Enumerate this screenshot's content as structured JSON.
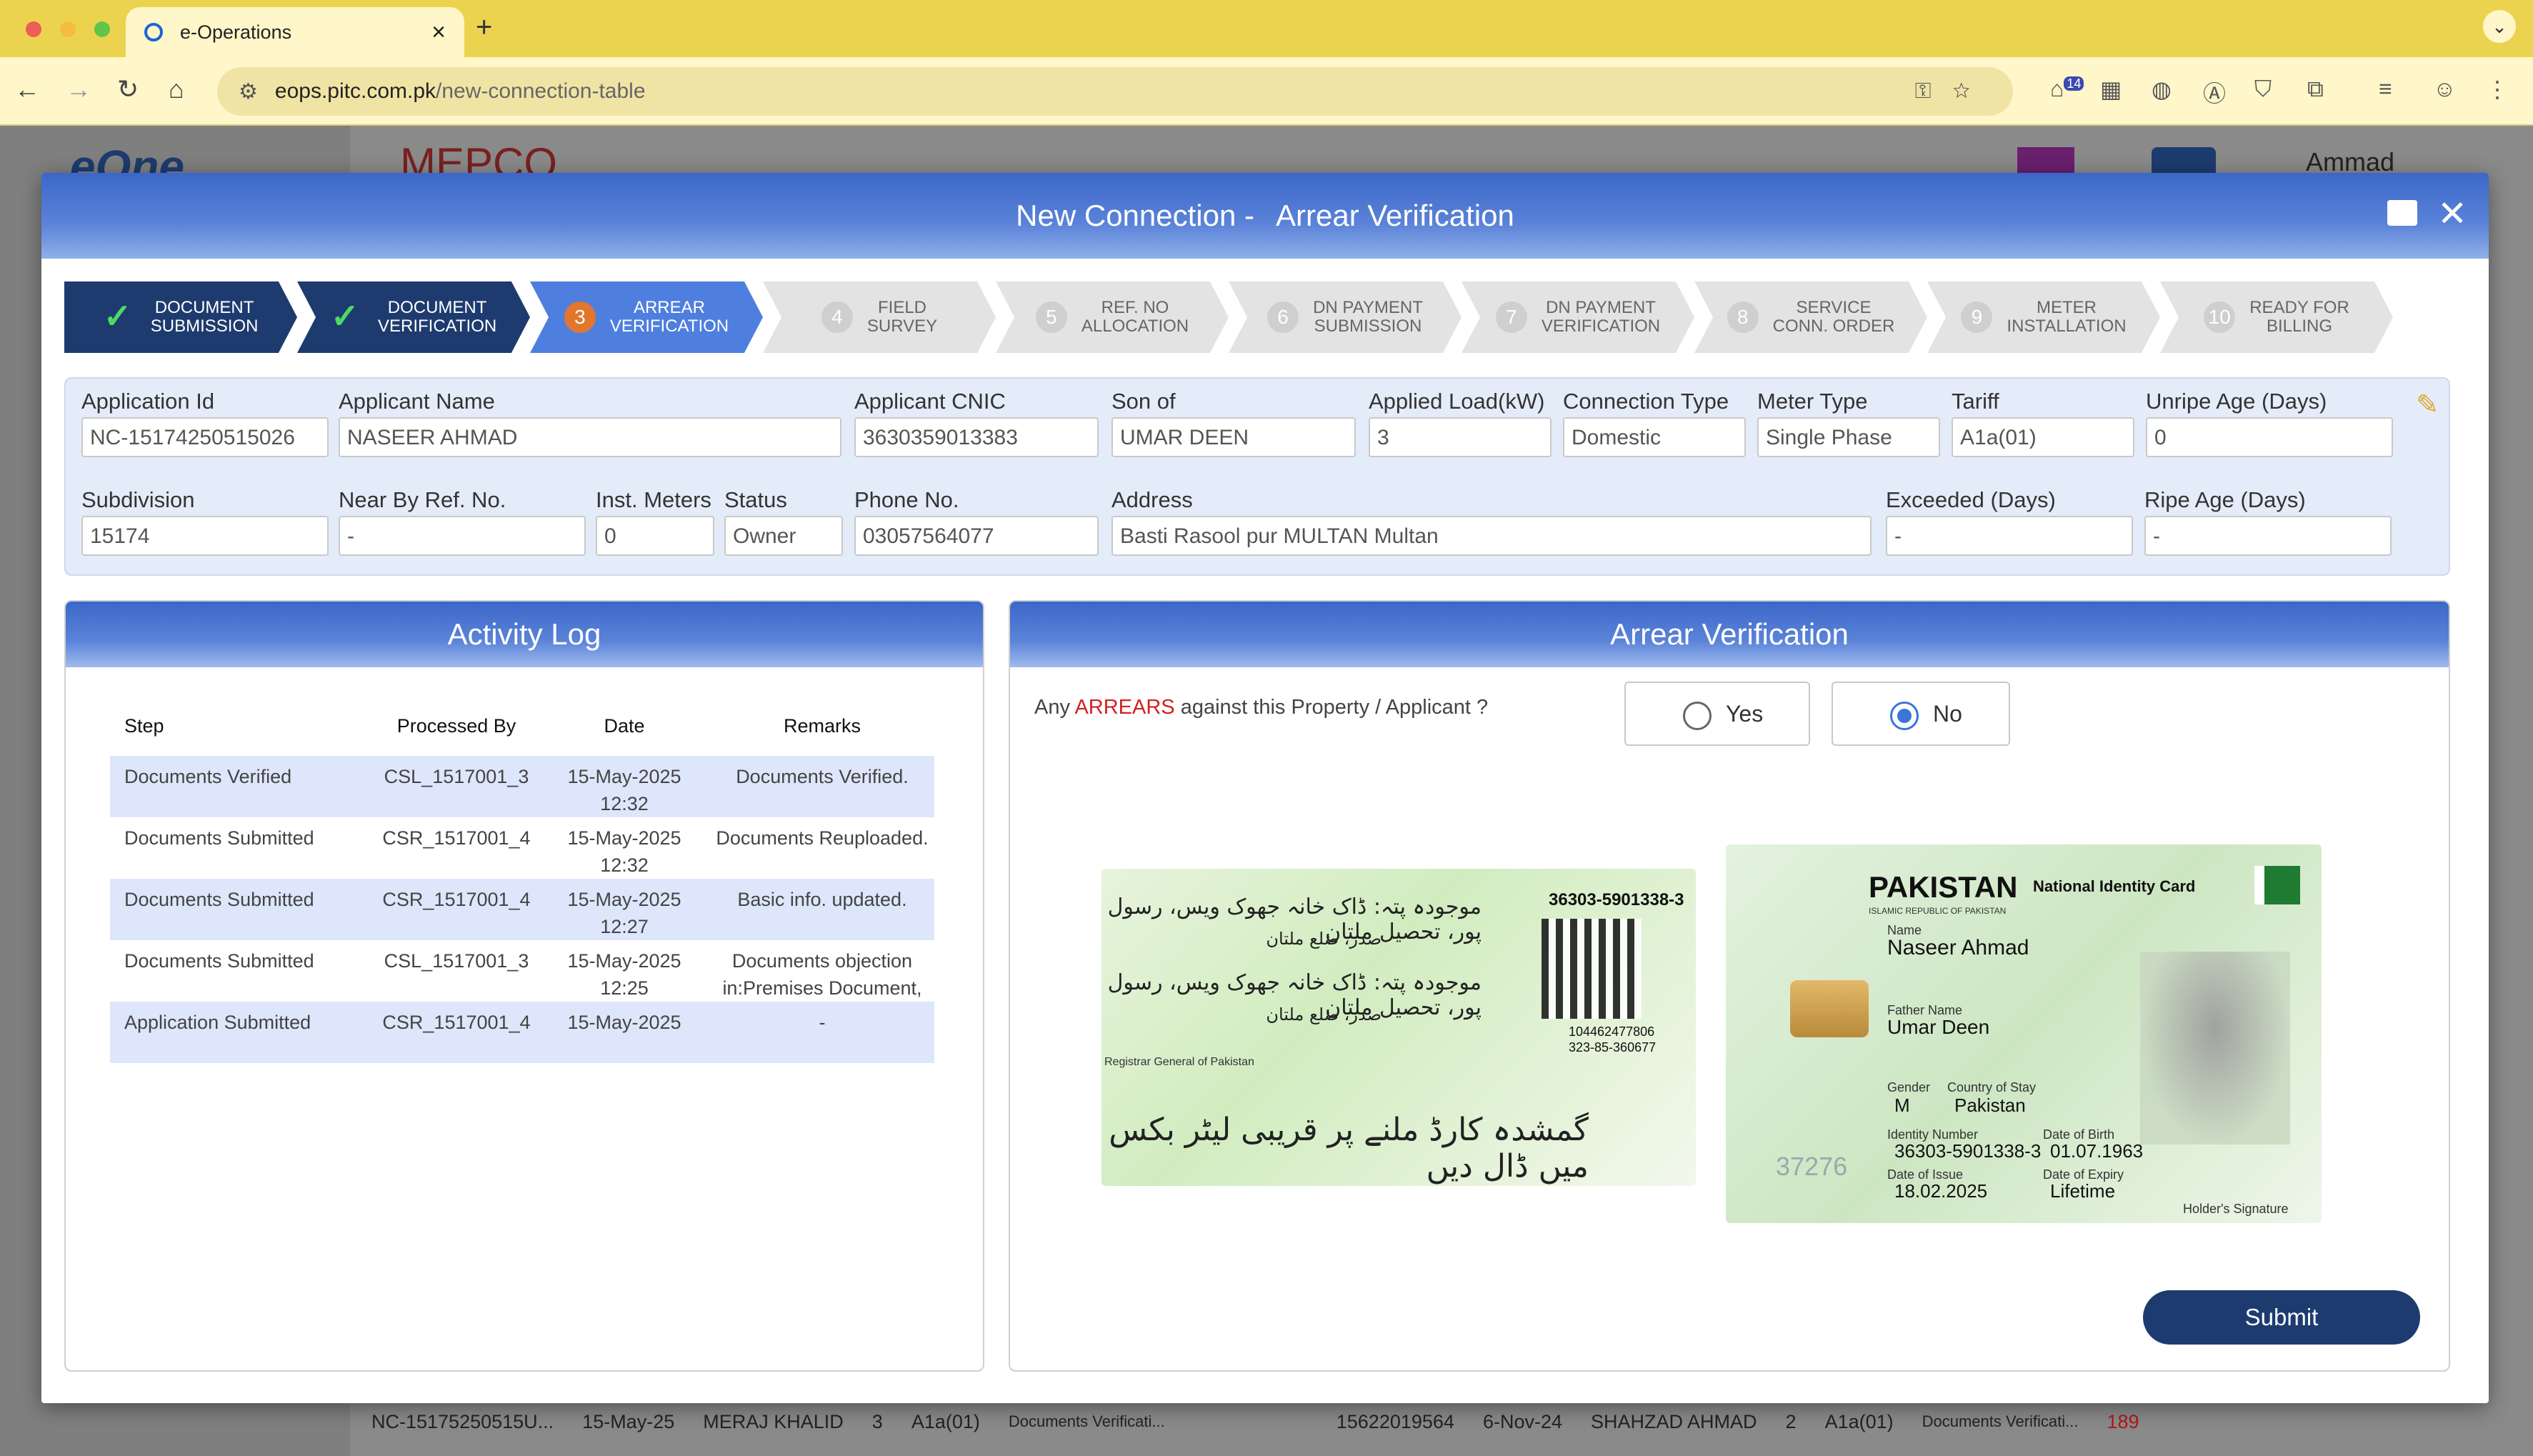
{
  "browser": {
    "tab_title": "e-Operations",
    "url_host": "eops.pitc.com.pk",
    "url_path": "/new-connection-table",
    "ext_badge": "14"
  },
  "background": {
    "user_name": "Ammad",
    "rows": [
      [
        "NC-15175250515U...",
        "15-May-25",
        "MERAJ KHALID",
        "3",
        "A1a(01)",
        "Documents Verificati..."
      ],
      [
        "15622019564",
        "6-Nov-24",
        "SHAHZAD AHMAD",
        "2",
        "A1a(01)",
        "Documents Verificati...",
        "189"
      ]
    ]
  },
  "modal": {
    "title_prefix": "New Connection -",
    "title_suffix": "Arrear Verification",
    "steps": [
      {
        "n": "1",
        "label1": "DOCUMENT",
        "label2": "SUBMISSION",
        "state": "done"
      },
      {
        "n": "2",
        "label1": "DOCUMENT",
        "label2": "VERIFICATION",
        "state": "done"
      },
      {
        "n": "3",
        "label1": "ARREAR",
        "label2": "VERIFICATION",
        "state": "active"
      },
      {
        "n": "4",
        "label1": "FIELD",
        "label2": "SURVEY",
        "state": "todo"
      },
      {
        "n": "5",
        "label1": "REF. NO",
        "label2": "ALLOCATION",
        "state": "todo"
      },
      {
        "n": "6",
        "label1": "DN PAYMENT",
        "label2": "SUBMISSION",
        "state": "todo"
      },
      {
        "n": "7",
        "label1": "DN PAYMENT",
        "label2": "VERIFICATION",
        "state": "todo"
      },
      {
        "n": "8",
        "label1": "SERVICE",
        "label2": "CONN. ORDER",
        "state": "todo"
      },
      {
        "n": "9",
        "label1": "METER",
        "label2": "INSTALLATION",
        "state": "todo"
      },
      {
        "n": "10",
        "label1": "READY FOR",
        "label2": "BILLING",
        "state": "todo"
      }
    ],
    "fields": {
      "application_id": {
        "label": "Application Id",
        "value": "NC-15174250515026"
      },
      "applicant_name": {
        "label": "Applicant Name",
        "value": "NASEER AHMAD"
      },
      "applicant_cnic": {
        "label": "Applicant CNIC",
        "value": "3630359013383"
      },
      "son_of": {
        "label": "Son of",
        "value": "UMAR DEEN"
      },
      "applied_load": {
        "label": "Applied Load(kW)",
        "value": "3"
      },
      "connection_type": {
        "label": "Connection Type",
        "value": "Domestic"
      },
      "meter_type": {
        "label": "Meter Type",
        "value": "Single Phase"
      },
      "tariff": {
        "label": "Tariff",
        "value": "A1a(01)"
      },
      "unripe_age": {
        "label": "Unripe Age (Days)",
        "value": "0"
      },
      "subdivision": {
        "label": "Subdivision",
        "value": "15174"
      },
      "near_by_ref": {
        "label": "Near By Ref. No.",
        "value": "-"
      },
      "inst_meters": {
        "label": "Inst. Meters",
        "value": "0"
      },
      "status": {
        "label": "Status",
        "value": "Owner"
      },
      "phone": {
        "label": "Phone No.",
        "value": "03057564077"
      },
      "address": {
        "label": "Address",
        "value": "Basti Rasool pur MULTAN Multan"
      },
      "exceeded": {
        "label": "Exceeded (Days)",
        "value": "-"
      },
      "ripe_age": {
        "label": "Ripe Age (Days)",
        "value": "-"
      }
    },
    "activity_log": {
      "title": "Activity Log",
      "headers": [
        "Step",
        "Processed By",
        "Date",
        "Remarks"
      ],
      "rows": [
        {
          "step": "Documents Verified",
          "by": "CSL_1517001_3",
          "date": "15-May-2025",
          "time": "12:32",
          "remarks": "Documents Verified.",
          "remarks2": ""
        },
        {
          "step": "Documents Submitted",
          "by": "CSR_1517001_4",
          "date": "15-May-2025",
          "time": "12:32",
          "remarks": "Documents Reuploaded.",
          "remarks2": ""
        },
        {
          "step": "Documents Submitted",
          "by": "CSR_1517001_4",
          "date": "15-May-2025",
          "time": "12:27",
          "remarks": "Basic info. updated.",
          "remarks2": ""
        },
        {
          "step": "Documents Submitted",
          "by": "CSL_1517001_3",
          "date": "15-May-2025",
          "time": "12:25",
          "remarks": "Documents objection",
          "remarks2": "in:Premises Document,"
        },
        {
          "step": "Application Submitted",
          "by": "CSR_1517001_4",
          "date": "15-May-2025",
          "time": "",
          "remarks": "-",
          "remarks2": ""
        }
      ]
    },
    "arrear": {
      "title": "Arrear Verification",
      "question_pre": "Any",
      "question_red": "ARREARS",
      "question_post": "against this Property / Applicant ?",
      "yes_label": "Yes",
      "no_label": "No",
      "selected": "No",
      "submit_label": "Submit"
    },
    "cnic_card": {
      "back_number": "36303-5901338-3",
      "back_serial1": "104462477806",
      "back_serial2": "323-85-360677",
      "registrar": "Registrar General of Pakistan",
      "urdu_addr1": "موجودہ پتہ: ڈاک خانہ جھوک ویس، رسول پور، تحصیل ملتان",
      "urdu_addr2": "صدر، ضلع ملتان",
      "urdu_lost": "گمشدہ کارڈ ملنے پر قریبی لیٹر بکس میں ڈال دیں",
      "country": "PAKISTAN",
      "card_type": "National Identity Card",
      "republic": "ISLAMIC REPUBLIC OF PAKISTAN",
      "name_label": "Name",
      "name": "Naseer Ahmad",
      "father_label": "Father Name",
      "father": "Umar Deen",
      "gender_label": "Gender",
      "gender": "M",
      "stay_label": "Country of Stay",
      "stay": "Pakistan",
      "idnum_label": "Identity Number",
      "idnum": "36303-5901338-3",
      "dob_label": "Date of Birth",
      "dob": "01.07.1963",
      "issue_label": "Date of Issue",
      "issue": "18.02.2025",
      "expiry_label": "Date of Expiry",
      "expiry": "Lifetime",
      "sig_label": "Holder's Signature",
      "holo": "37276"
    }
  },
  "colors": {
    "primary": "#1d3b6e",
    "active_step": "#4f7fde",
    "accent": "#e2762d",
    "arrears": "#d42020"
  }
}
